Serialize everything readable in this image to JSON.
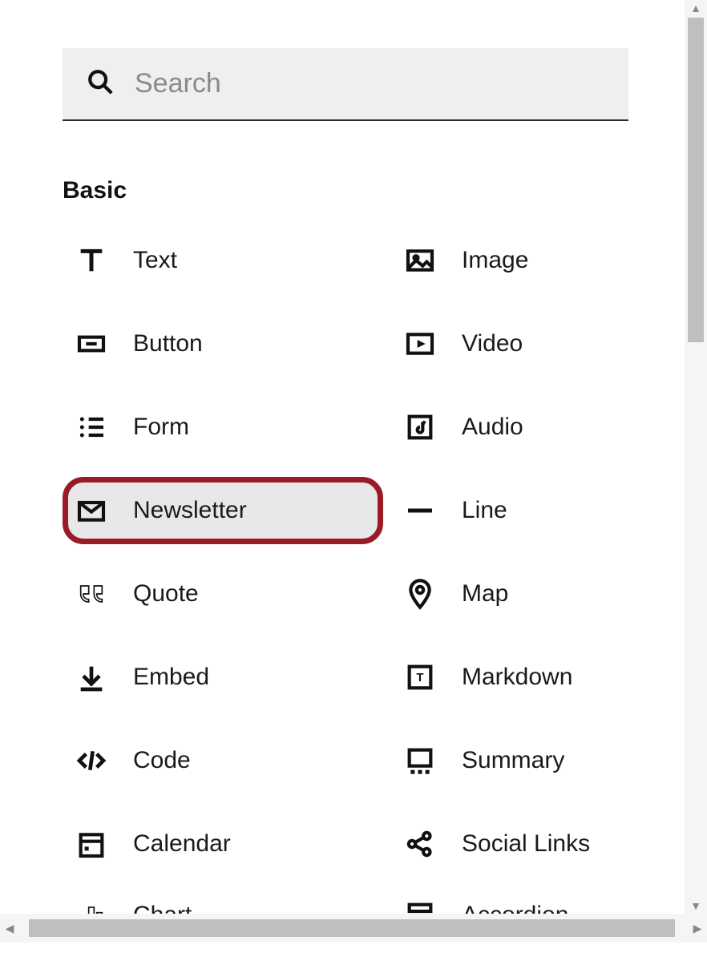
{
  "search": {
    "placeholder": "Search",
    "value": ""
  },
  "section": {
    "title": "Basic"
  },
  "blocks": {
    "left": [
      {
        "label": "Text"
      },
      {
        "label": "Button"
      },
      {
        "label": "Form"
      },
      {
        "label": "Newsletter",
        "highlight": true
      },
      {
        "label": "Quote"
      },
      {
        "label": "Embed"
      },
      {
        "label": "Code"
      },
      {
        "label": "Calendar"
      },
      {
        "label": "Chart"
      }
    ],
    "right": [
      {
        "label": "Image"
      },
      {
        "label": "Video"
      },
      {
        "label": "Audio"
      },
      {
        "label": "Line"
      },
      {
        "label": "Map"
      },
      {
        "label": "Markdown"
      },
      {
        "label": "Summary"
      },
      {
        "label": "Social Links"
      },
      {
        "label": "Accordion"
      }
    ]
  }
}
